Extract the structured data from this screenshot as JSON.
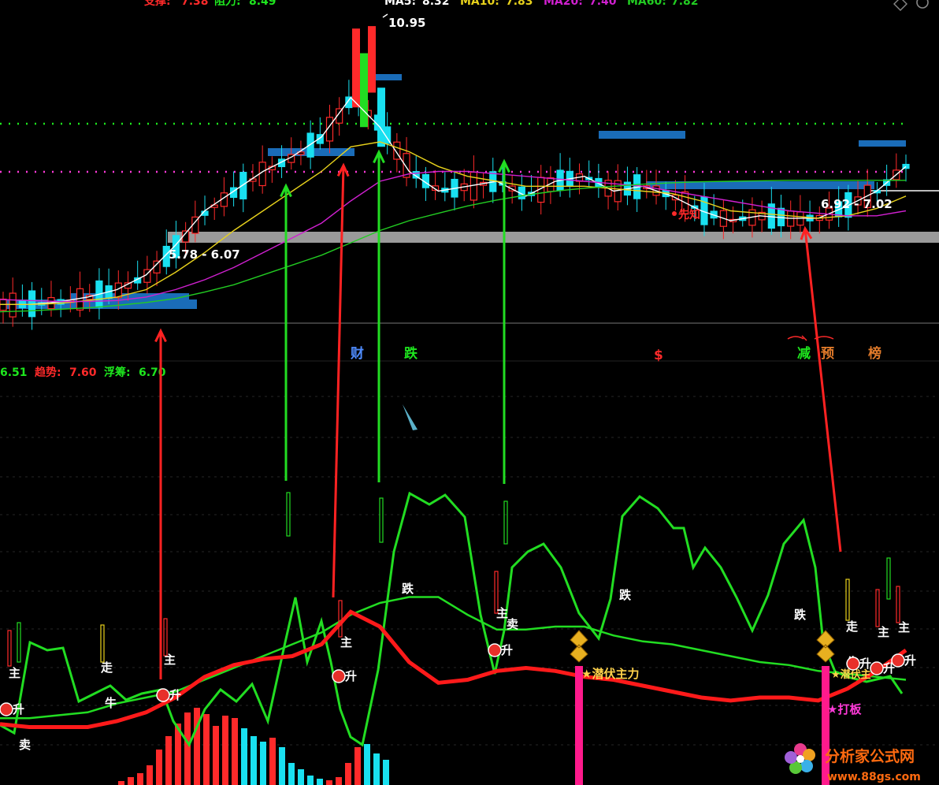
{
  "header": {
    "support_label": "支撑:",
    "support_value": "7.38",
    "resist_label": "阻力:",
    "resist_value": "8.49",
    "ma5_label": "MA5:",
    "ma5_value": "8.32",
    "ma10_label": "MA10:",
    "ma10_value": "7.83",
    "ma20_label": "MA20:",
    "ma20_value": "7.40",
    "ma60_label": "MA60:",
    "ma60_value": "7.82"
  },
  "price_labels": {
    "high": "10.95",
    "zone_left": "5.78 - 6.07",
    "zone_right": "6.92 - 7.02",
    "xianzhi": "先知"
  },
  "event_markers": [
    {
      "text": "财",
      "color": "#4f8cff"
    },
    {
      "text": "跌",
      "color": "#1ee61e"
    },
    {
      "text": "$",
      "color": "#ff2a2a"
    },
    {
      "text": "减",
      "color": "#1ee61e"
    },
    {
      "text": "预",
      "color": "#e07a2a"
    },
    {
      "text": "榜",
      "color": "#e07a2a"
    }
  ],
  "indicator_header": {
    "first_value": "6.51",
    "trend_label": "趋势:",
    "trend_value": "7.60",
    "float_label": "浮筹:",
    "float_value": "6.70"
  },
  "indicator_labels": {
    "zhu": "主",
    "zou": "走",
    "niu": "牛",
    "sheng": "升",
    "mai": "卖",
    "die": "跌",
    "qianfu": "★潜伏主力",
    "qianfu2": "★潜伏主",
    "daban": "★打板"
  },
  "watermark": {
    "name": "分析家公式网",
    "url": "www.88gs.com"
  },
  "colors": {
    "up": "#ff2a2a",
    "down": "#19e0f0",
    "green": "#22dd22",
    "trend": "#ff1a1a",
    "ma5": "#ffffff",
    "ma10": "#e8d21c",
    "ma20": "#d020d0",
    "ma60": "#22cc22"
  },
  "chart_data": {
    "type": "line",
    "price_panel": {
      "series": [
        {
          "name": "MA5",
          "color": "#ffffff",
          "values": [
            5.3,
            5.3,
            5.35,
            5.45,
            5.6,
            5.9,
            6.5,
            7.2,
            7.6,
            8.0,
            8.3,
            8.7,
            9.5,
            8.9,
            8.0,
            7.6,
            7.7,
            7.8,
            7.5,
            7.8,
            7.9,
            7.6,
            7.7,
            7.5,
            7.2,
            7.0,
            7.1,
            7.05,
            7.05,
            7.3,
            7.6,
            8.1
          ]
        },
        {
          "name": "MA10",
          "color": "#e8d21c",
          "values": [
            5.3,
            5.3,
            5.32,
            5.38,
            5.45,
            5.6,
            5.95,
            6.35,
            6.8,
            7.2,
            7.6,
            8.0,
            8.5,
            8.6,
            8.4,
            8.1,
            7.9,
            7.8,
            7.7,
            7.7,
            7.7,
            7.65,
            7.6,
            7.55,
            7.4,
            7.2,
            7.15,
            7.1,
            7.05,
            7.1,
            7.25,
            7.5
          ]
        },
        {
          "name": "MA20",
          "color": "#d020d0",
          "values": [
            5.4,
            5.38,
            5.36,
            5.36,
            5.38,
            5.45,
            5.6,
            5.8,
            6.05,
            6.35,
            6.65,
            6.95,
            7.4,
            7.8,
            7.95,
            8.0,
            8.0,
            7.95,
            7.9,
            7.85,
            7.8,
            7.75,
            7.7,
            7.6,
            7.5,
            7.4,
            7.3,
            7.2,
            7.15,
            7.1,
            7.1,
            7.2
          ]
        },
        {
          "name": "MA60",
          "color": "#22cc22",
          "values": [
            5.15,
            5.17,
            5.2,
            5.23,
            5.28,
            5.34,
            5.42,
            5.55,
            5.7,
            5.9,
            6.1,
            6.3,
            6.55,
            6.8,
            7.0,
            7.15,
            7.3,
            7.42,
            7.52,
            7.6,
            7.66,
            7.7,
            7.74,
            7.77,
            7.79,
            7.8,
            7.81,
            7.82,
            7.82,
            7.82,
            7.82,
            7.82
          ]
        }
      ]
    },
    "indicator_panel": {
      "series": [
        {
          "name": "趋势",
          "values": [
            15,
            14,
            14,
            14,
            16,
            19,
            24,
            31,
            35,
            37,
            38,
            42,
            53,
            48,
            36,
            29,
            30,
            33,
            34,
            33,
            31,
            30,
            28,
            26,
            24,
            23,
            24,
            24,
            23,
            27,
            33,
            40
          ]
        },
        {
          "name": "浮筹",
          "values": [
            17,
            17,
            18,
            19,
            22,
            24,
            26,
            30,
            34,
            38,
            42,
            46,
            52,
            56,
            58,
            58,
            52,
            47,
            47,
            48,
            48,
            45,
            43,
            42,
            40,
            38,
            36,
            35,
            33,
            32,
            31,
            30
          ]
        }
      ]
    }
  }
}
